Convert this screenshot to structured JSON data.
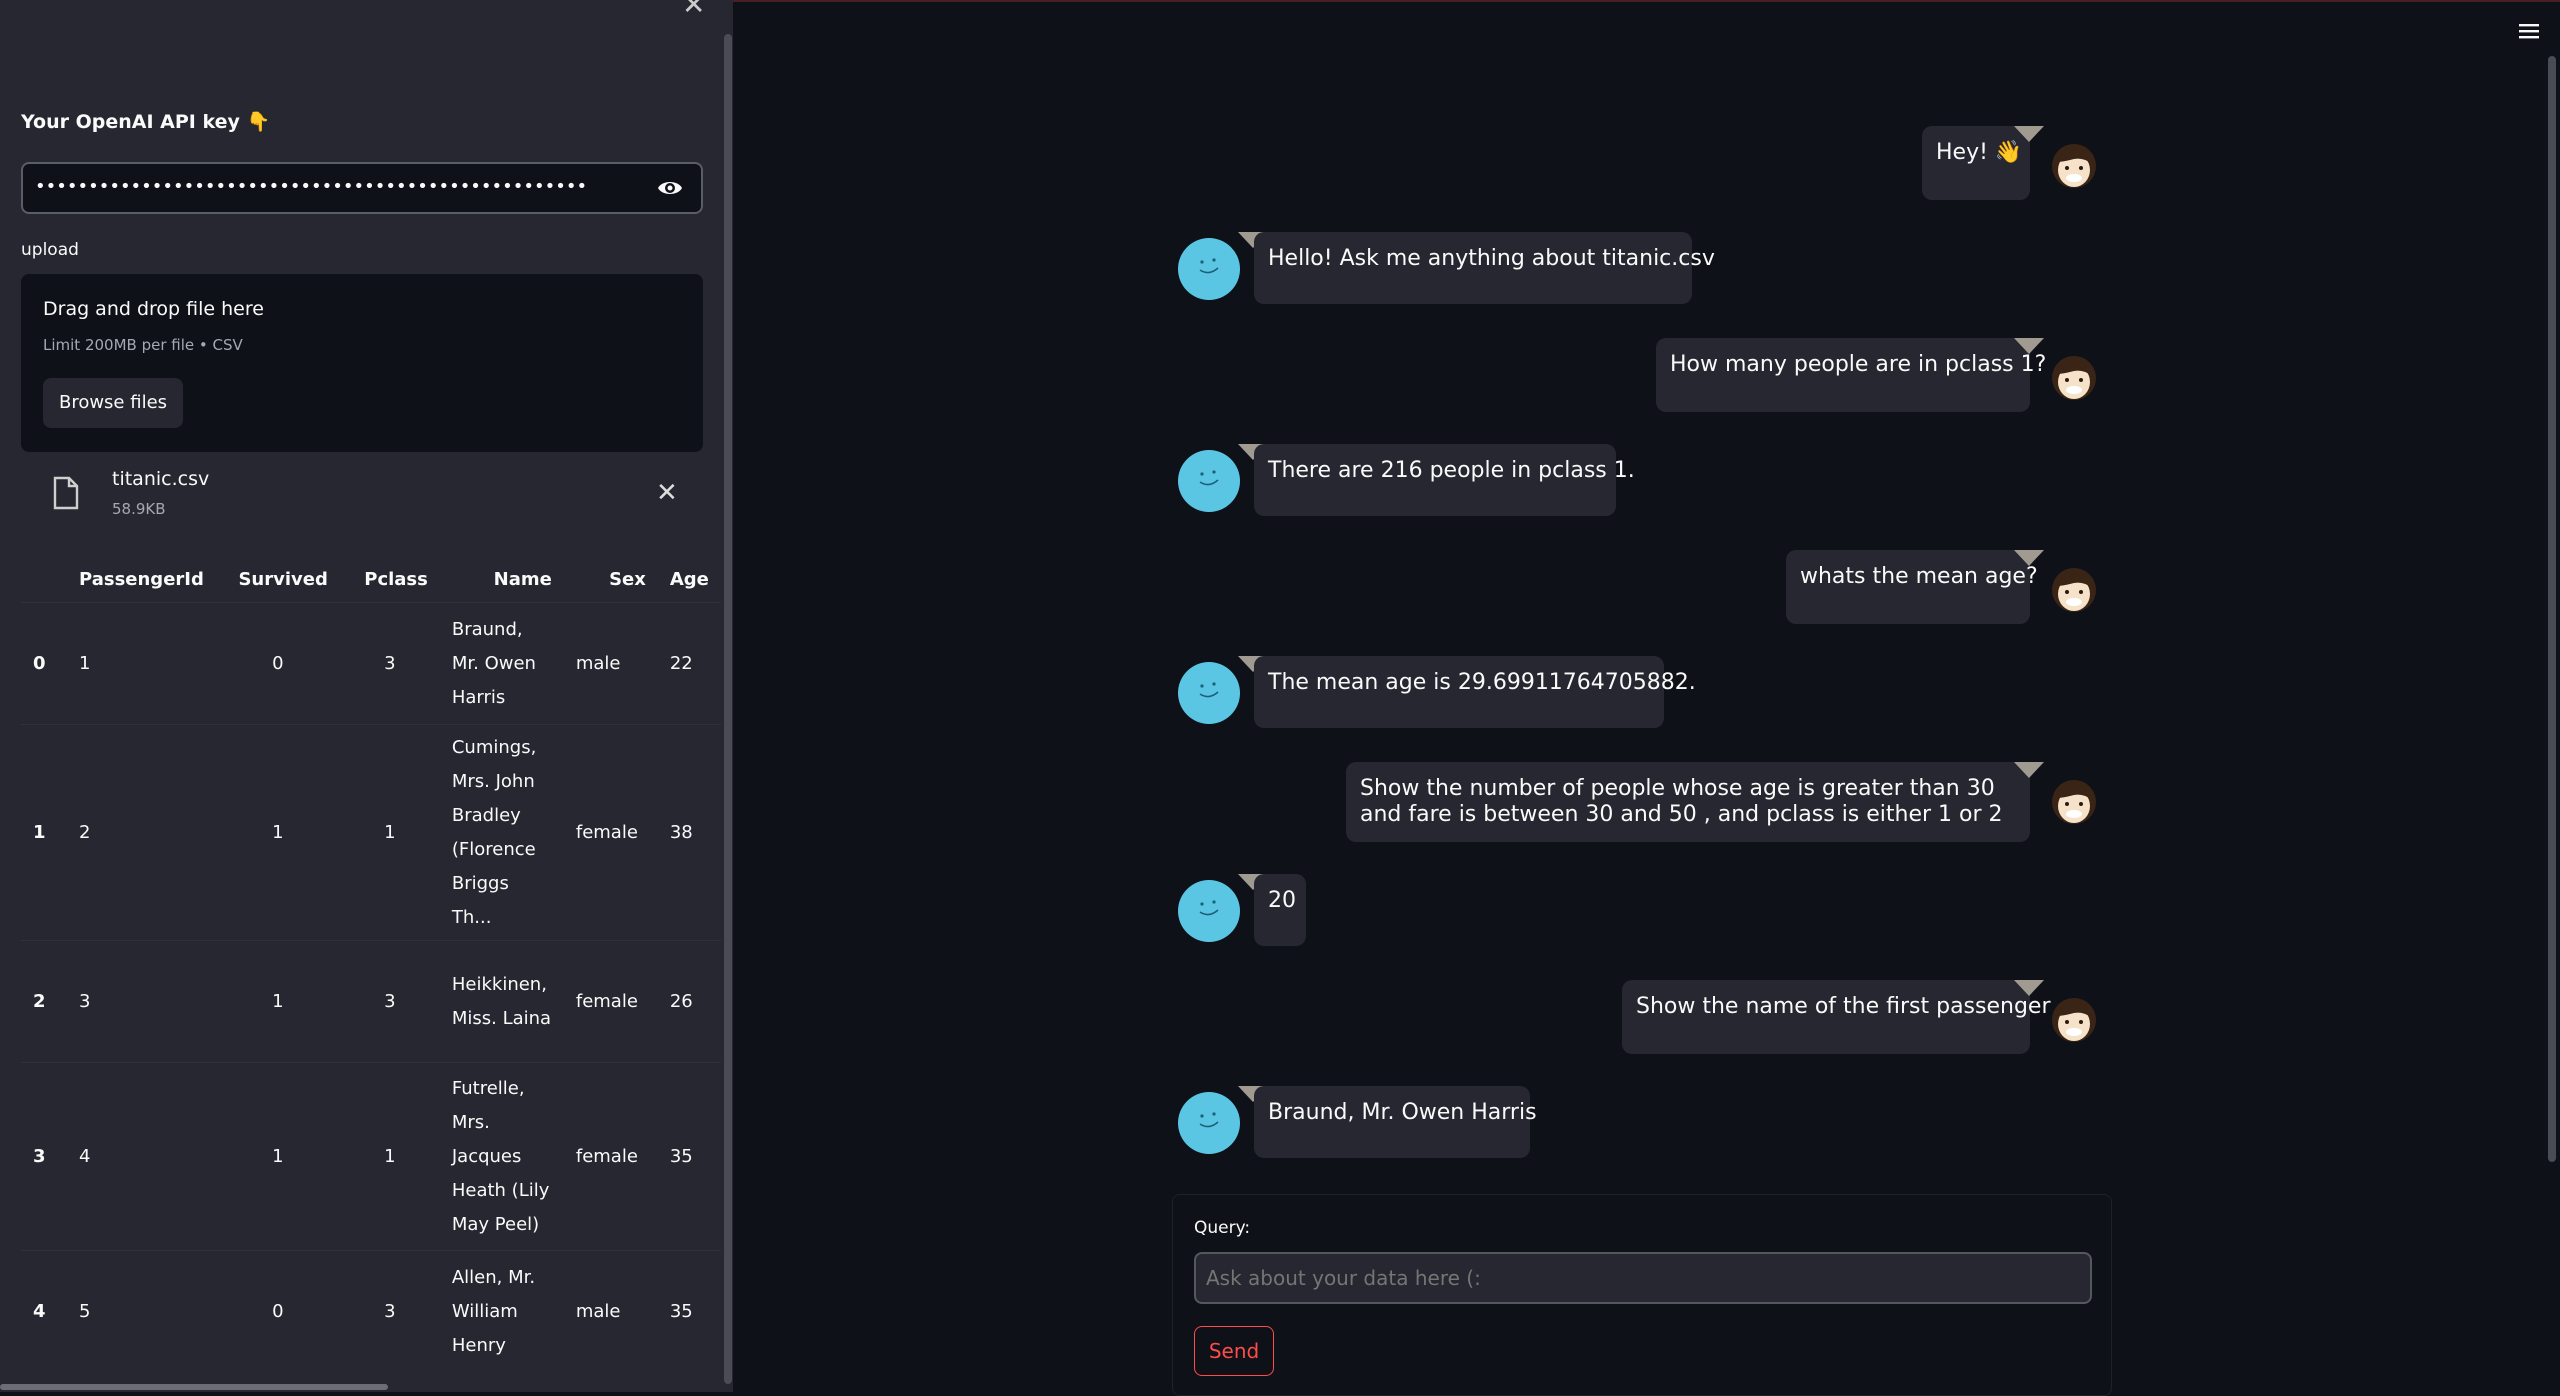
{
  "sidebar": {
    "api_key_label": "Your OpenAI API key 👇",
    "api_key_value": "••••••••••••••••••••••••••••••••••••••••••••••••••••",
    "upload_label": "upload",
    "dropzone_title": "Drag and drop file here",
    "dropzone_limit": "Limit 200MB per file • CSV",
    "browse_label": "Browse files",
    "file": {
      "name": "titanic.csv",
      "size": "58.9KB"
    },
    "table": {
      "columns": [
        "",
        "PassengerId",
        "Survived",
        "Pclass",
        "Name",
        "Sex",
        "Age"
      ],
      "rows": [
        [
          "0",
          "1",
          "0",
          "3",
          "Braund, Mr. Owen Harris",
          "male",
          "22"
        ],
        [
          "1",
          "2",
          "1",
          "1",
          "Cumings, Mrs. John Bradley (Florence Briggs Th...",
          "female",
          "38"
        ],
        [
          "2",
          "3",
          "1",
          "3",
          "Heikkinen, Miss. Laina",
          "female",
          "26"
        ],
        [
          "3",
          "4",
          "1",
          "1",
          "Futrelle, Mrs. Jacques Heath (Lily May Peel)",
          "female",
          "35"
        ],
        [
          "4",
          "5",
          "0",
          "3",
          "Allen, Mr. William Henry",
          "male",
          "35"
        ]
      ]
    }
  },
  "chat": {
    "messages": [
      {
        "role": "user",
        "text": "Hey! 👋"
      },
      {
        "role": "bot",
        "text": "Hello! Ask me anything about titanic.csv"
      },
      {
        "role": "user",
        "text": "How many people are in pclass 1?"
      },
      {
        "role": "bot",
        "text": "There are 216 people in pclass 1."
      },
      {
        "role": "user",
        "text": "whats the mean age?"
      },
      {
        "role": "bot",
        "text": "The mean age is 29.69911764705882."
      },
      {
        "role": "user",
        "text": "Show the number of people whose age is greater than 30 and fare is between 30 and 50 , and pclass is either 1 or 2"
      },
      {
        "role": "bot",
        "text": "20"
      },
      {
        "role": "user",
        "text": "Show the name of the first passenger"
      },
      {
        "role": "bot",
        "text": "Braund, Mr. Owen Harris"
      }
    ]
  },
  "query": {
    "label": "Query:",
    "placeholder": "Ask about your data here (:",
    "send_label": "Send"
  }
}
